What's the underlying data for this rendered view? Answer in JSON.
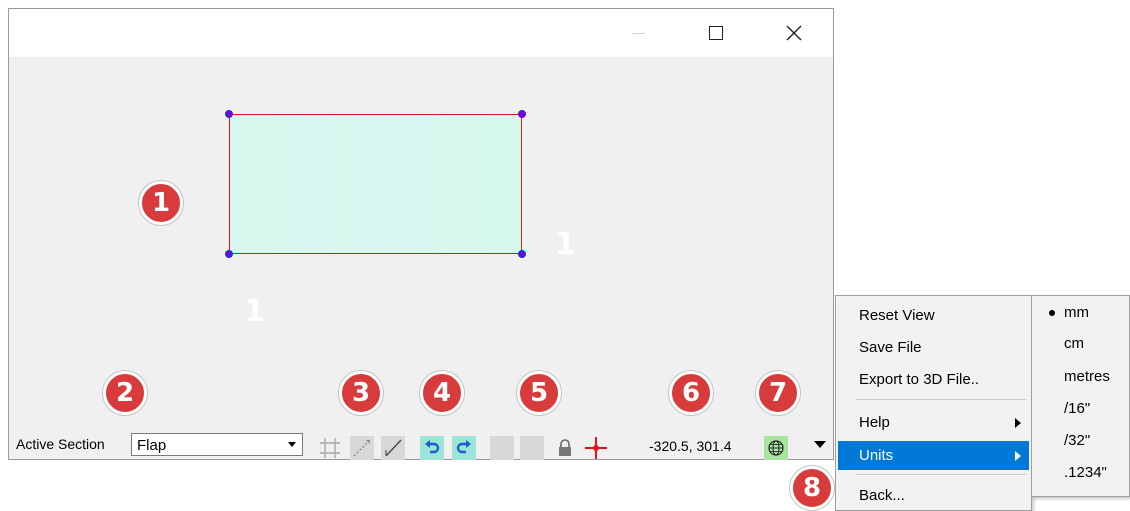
{
  "window": {
    "controls": {
      "minimize": "minimize",
      "maximize": "maximize",
      "close": "close"
    }
  },
  "canvas": {
    "shape_fill": "#d6f7ee",
    "shape_outline": "#e0141b",
    "vertex_color": "#6a0cd0",
    "overlay_labels": [
      "1",
      "1"
    ]
  },
  "status_bar": {
    "active_section_label": "Active Section",
    "active_section_value": "Flap",
    "tools": [
      {
        "name": "grid-icon",
        "state": "disabled"
      },
      {
        "name": "snap-line-icon",
        "state": "disabled"
      },
      {
        "name": "draw-line-icon",
        "state": "enabled"
      },
      {
        "name": "undo-icon",
        "state": "enabled"
      },
      {
        "name": "redo-icon",
        "state": "enabled"
      },
      {
        "name": "blank-tool-icon",
        "state": "disabled"
      },
      {
        "name": "blank-tool-icon",
        "state": "disabled"
      },
      {
        "name": "lock-icon",
        "state": "disabled"
      },
      {
        "name": "crosshair-icon",
        "state": "enabled"
      },
      {
        "name": "globe-icon",
        "state": "enabled"
      }
    ],
    "coordinates": "-320.5, 301.4"
  },
  "callouts": [
    "1",
    "2",
    "3",
    "4",
    "5",
    "6",
    "7",
    "8"
  ],
  "context_menu": {
    "items": [
      {
        "label": "Reset View"
      },
      {
        "label": "Save File"
      },
      {
        "label": "Export to 3D File.."
      },
      {
        "label": "Help",
        "has_submenu": true
      },
      {
        "label": "Units",
        "has_submenu": true,
        "highlighted": true
      },
      {
        "label": "Back..."
      }
    ]
  },
  "units_submenu": {
    "selected": "mm",
    "items": [
      "mm",
      "cm",
      "metres",
      "/16\"",
      "/32\"",
      ".1234\""
    ]
  },
  "colors": {
    "callout": "#d83b3b",
    "highlight": "#0078d7",
    "crosshair": "#e8141b"
  }
}
